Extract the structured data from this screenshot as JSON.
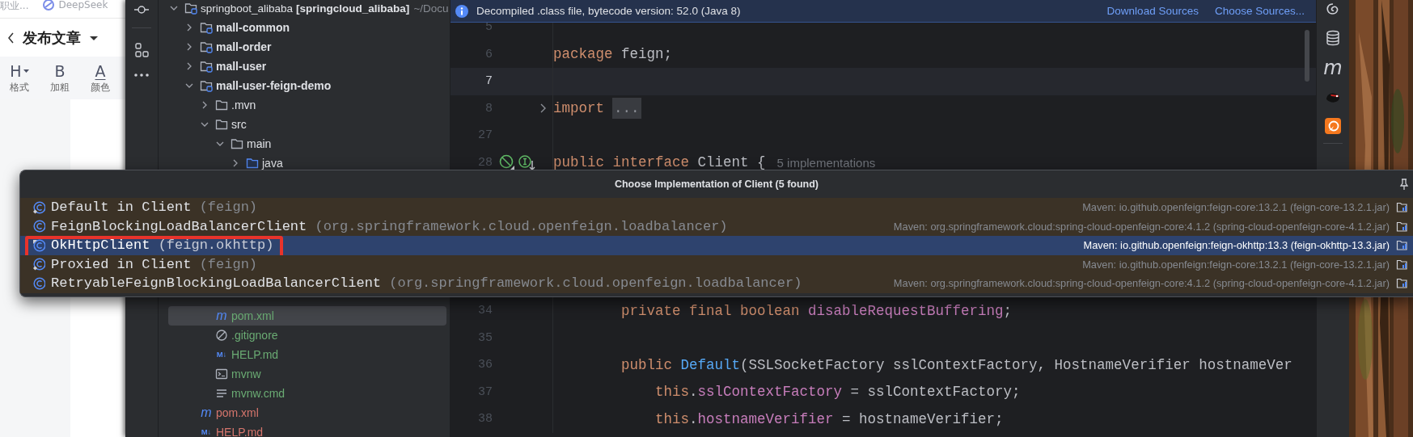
{
  "browser": {
    "bookmarks": [
      {
        "kind": "plain",
        "label": "职业..."
      },
      {
        "kind": "with-icon",
        "label": "DeepSeek"
      }
    ],
    "page_title": "发布文章",
    "toolbar": [
      {
        "kind": "heading",
        "glyph": "H",
        "label": "格式"
      },
      {
        "kind": "bold",
        "glyph": "B",
        "label": "加粗"
      },
      {
        "kind": "color",
        "glyph": "A",
        "label": "颜色"
      }
    ]
  },
  "project": {
    "items": [
      {
        "kind": "module-root",
        "name": "springboot_alibaba",
        "qualifier": "[springcloud_alibaba]",
        "path": "~/Docu",
        "expanded": true,
        "selected": false,
        "children": [
          {
            "kind": "module",
            "name": "mall-common",
            "expanded": false,
            "selected": false
          },
          {
            "kind": "module",
            "name": "mall-order",
            "expanded": false,
            "selected": false
          },
          {
            "kind": "module",
            "name": "mall-user",
            "expanded": false,
            "selected": false
          },
          {
            "kind": "module",
            "name": "mall-user-feign-demo",
            "expanded": true,
            "selected": false,
            "children": [
              {
                "kind": "folder",
                "name": ".mvn",
                "expanded": false,
                "selected": false
              },
              {
                "kind": "folder",
                "name": "src",
                "expanded": true,
                "selected": false,
                "children": [
                  {
                    "kind": "folder",
                    "name": "main",
                    "expanded": true,
                    "selected": false,
                    "children": [
                      {
                        "kind": "source-folder",
                        "name": "java",
                        "expanded": false,
                        "selected": false
                      }
                    ]
                  }
                ]
              },
              {
                "kind": "maven-file",
                "icon_text": "m",
                "name": "pom.xml",
                "color": "#6aab73",
                "selected": true
              },
              {
                "kind": "ignore-file",
                "name": ".gitignore",
                "color": "#6aab73",
                "selected": false
              },
              {
                "kind": "markdown-file",
                "icon_text": "M↓",
                "name": "HELP.md",
                "color": "#6aab73",
                "selected": false
              },
              {
                "kind": "script-file",
                "name": "mvnw",
                "color": "#6aab73",
                "selected": false
              },
              {
                "kind": "text-file",
                "name": "mvnw.cmd",
                "color": "#6aab73",
                "selected": false
              }
            ]
          },
          {
            "kind": "maven-file",
            "icon_text": "m",
            "name": "pom.xml",
            "color": "#d5756c",
            "selected": false
          },
          {
            "kind": "markdown-file",
            "icon_text": "M↓",
            "name": "HELP.md",
            "color": "#d5756c",
            "selected": false
          }
        ]
      }
    ]
  },
  "editor": {
    "banner": {
      "message": "Decompiled .class file, bytecode version: 52.0 (Java 8)",
      "actions": [
        "Download Sources",
        "Choose Sources..."
      ]
    },
    "lines": [
      {
        "number": "5",
        "kind": "code",
        "current": false
      },
      {
        "number": "6",
        "kind": "code",
        "current": false,
        "tokens": [
          {
            "text": "package",
            "kind": "keyword"
          },
          {
            "text": " feign;",
            "kind": "plain"
          }
        ]
      },
      {
        "number": "7",
        "kind": "code",
        "current": true
      },
      {
        "number": "8",
        "kind": "code",
        "current": false,
        "folded": true,
        "tokens": [
          {
            "text": "import",
            "kind": "keyword"
          },
          {
            "text": "...",
            "kind": "fold"
          }
        ]
      },
      {
        "number": "27",
        "kind": "code",
        "current": false
      },
      {
        "number": "28",
        "kind": "declaration",
        "current": false,
        "tokens": [
          {
            "text": "public interface",
            "kind": "keyword"
          },
          {
            "text": " Client {",
            "kind": "plain"
          },
          {
            "text": "5 implementations",
            "kind": "hint"
          }
        ]
      },
      {
        "number": "34",
        "kind": "code",
        "current": false,
        "tokens": [
          {
            "text": "        private final boolean",
            "kind": "keyword"
          },
          {
            "text": " disableRequestBuffering",
            "kind": "field"
          },
          {
            "text": ";",
            "kind": "plain"
          }
        ]
      },
      {
        "number": "35",
        "kind": "code",
        "current": false
      },
      {
        "number": "36",
        "kind": "code",
        "current": false,
        "tokens": [
          {
            "text": "        public",
            "kind": "keyword"
          },
          {
            "text": " Default",
            "kind": "method"
          },
          {
            "text": "(SSLSocketFactory sslContextFactory, HostnameVerifier hostnameVer",
            "kind": "plain"
          }
        ]
      },
      {
        "number": "37",
        "kind": "code",
        "current": false,
        "tokens": [
          {
            "text": "            this",
            "kind": "keyword"
          },
          {
            "text": ".",
            "kind": "plain"
          },
          {
            "text": "sslContextFactory",
            "kind": "field"
          },
          {
            "text": " = sslContextFactory;",
            "kind": "plain"
          }
        ]
      },
      {
        "number": "38",
        "kind": "code",
        "current": false,
        "tokens": [
          {
            "text": "            this",
            "kind": "keyword"
          },
          {
            "text": ".",
            "kind": "plain"
          },
          {
            "text": "hostnameVerifier",
            "kind": "field"
          },
          {
            "text": " = hostnameVerifier;",
            "kind": "plain"
          }
        ]
      }
    ]
  },
  "right_toolbar": {
    "glyph_button": "m"
  },
  "implementations_popup": {
    "title": "Choose Implementation of Client (5 found)",
    "rows": [
      {
        "kind": "nested",
        "name": "Default in Client",
        "package": "(feign)",
        "location": "Maven: io.github.openfeign:feign-core:13.2.1 (feign-core-13.2.1.jar)",
        "selected": false
      },
      {
        "kind": "class",
        "name": "FeignBlockingLoadBalancerClient",
        "package": "(org.springframework.cloud.openfeign.loadbalancer)",
        "location": "Maven: org.springframework.cloud:spring-cloud-openfeign-core:4.1.2 (spring-cloud-openfeign-core-4.1.2.jar)",
        "selected": false
      },
      {
        "kind": "final",
        "name": "OkHttpClient",
        "package": "(feign.okhttp)",
        "location": "Maven: io.github.openfeign:feign-okhttp:13.3 (feign-okhttp-13.3.jar)",
        "selected": true
      },
      {
        "kind": "nested",
        "name": "Proxied in Client",
        "package": "(feign)",
        "location": "Maven: io.github.openfeign:feign-core:13.2.1 (feign-core-13.2.1.jar)",
        "selected": false
      },
      {
        "kind": "class",
        "name": "RetryableFeignBlockingLoadBalancerClient",
        "package": "(org.springframework.cloud.openfeign.loadbalancer)",
        "location": "Maven: org.springframework.cloud:spring-cloud-openfeign-core:4.1.2 (spring-cloud-openfeign-core-4.1.2.jar)",
        "selected": false
      }
    ]
  }
}
